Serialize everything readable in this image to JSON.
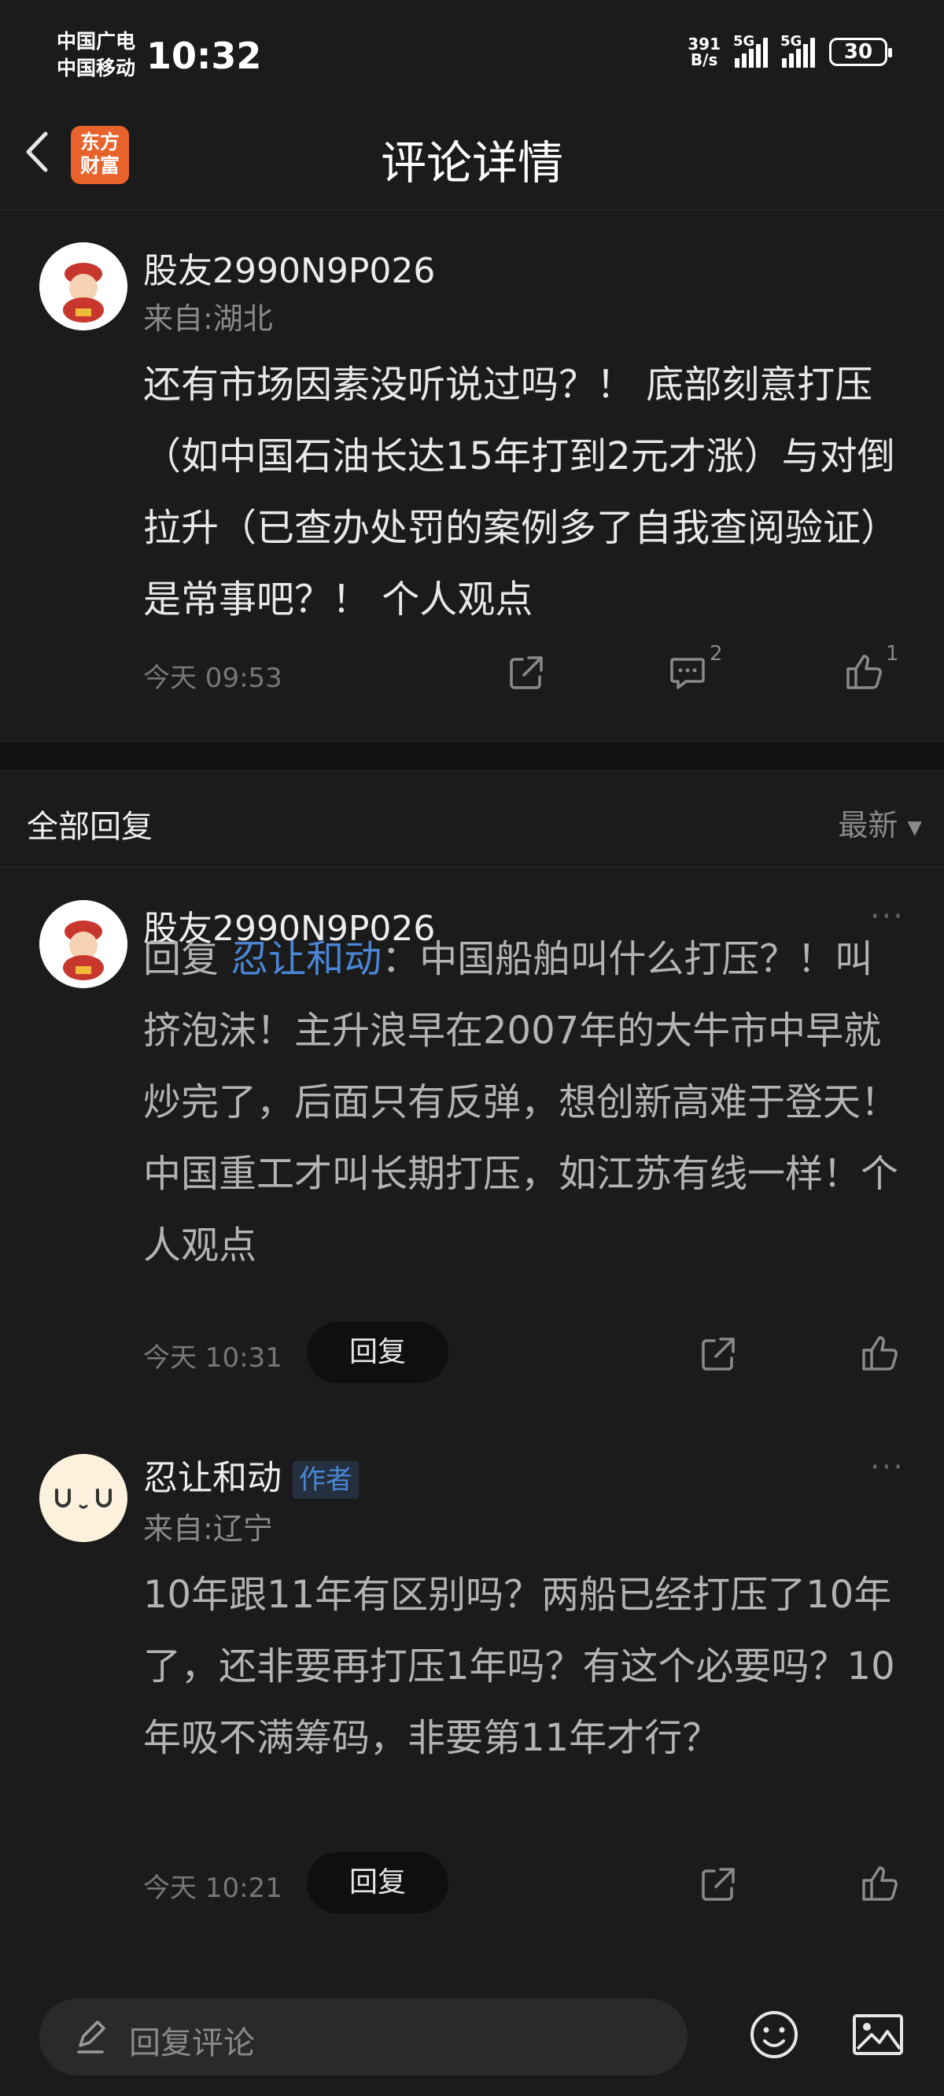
{
  "status": {
    "carrier1": "中国广电",
    "carrier2": "中国移动",
    "time": "10:32",
    "net_speed_value": "391",
    "net_speed_unit": "B/s",
    "sim1_label": "5G",
    "sim2_label": "5G",
    "battery": "30"
  },
  "header": {
    "title": "评论详情",
    "logo_line1": "东方",
    "logo_line2": "财富"
  },
  "main_comment": {
    "username": "股友2990N9P026",
    "from": "来自:湖北",
    "text": "还有市场因素没听说过吗？！ 底部刻意打压（如中国石油长达15年打到2元才涨）与对倒拉升（已查办处罚的案例多了自我查阅验证）是常事吧？！ 个人观点",
    "time": "今天 09:53",
    "comment_count": "2",
    "like_count": "1"
  },
  "replies_section": {
    "title": "全部回复",
    "sort_label": "最新"
  },
  "replies": [
    {
      "username": "股友2990N9P026",
      "reply_prefix": "回复 ",
      "mention": "忍让和动",
      "text": "：中国船舶叫什么打压？！叫挤泡沫！主升浪早在2007年的大牛市中早就炒完了，后面只有反弹，想创新高难于登天！中国重工才叫长期打压，如江苏有线一样！个人观点",
      "time": "今天 10:31",
      "reply_label": "回复",
      "more": "···"
    },
    {
      "username": "忍让和动",
      "author_tag": "作者",
      "from": "来自:辽宁",
      "text": "10年跟11年有区别吗？两船已经打压了10年了，还非要再打压1年吗？有这个必要吗？10年吸不满筹码，非要第11年才行？",
      "time": "今天 10:21",
      "reply_label": "回复",
      "more": "···"
    }
  ],
  "bottom": {
    "placeholder": "回复评论"
  },
  "colors": {
    "background": "#1b1b1b",
    "accent_blue": "#4a86d6",
    "logo_orange": "#e8622c"
  },
  "icons": [
    "back-arrow-icon",
    "share-icon",
    "comment-icon",
    "like-icon",
    "more-icon",
    "pen-icon",
    "emoji-icon",
    "image-icon"
  ]
}
